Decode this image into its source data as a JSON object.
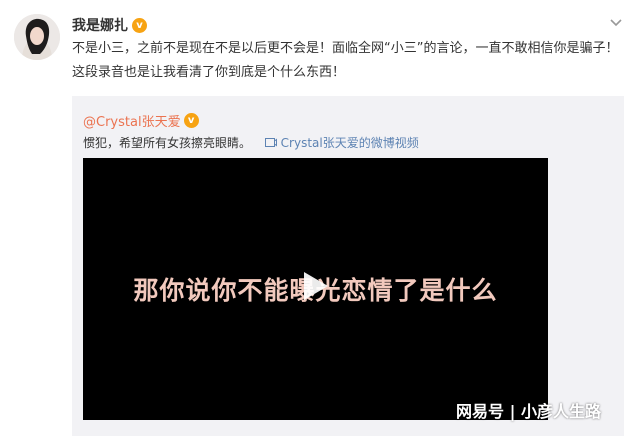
{
  "post": {
    "username": "我是娜扎",
    "verified_badge": "v",
    "text": "不是小三，之前不是现在不是以后更不会是！面临全网“小三”的言论，一直不敢相信你是骗子！这段录音也是让我看清了你到底是个什么东西！"
  },
  "repost": {
    "username": "@Crystal张天爱",
    "verified_badge": "v",
    "text": "惯犯，希望所有女孩擦亮眼睛。",
    "video_link": "Crystal张天爱的微博视频"
  },
  "video": {
    "subtitle": "那你说你不能曝光恋情了是什么"
  },
  "watermark": "网易号 | 小彦人生路",
  "icons": {
    "more": "chevron-down-icon",
    "play": "play-icon",
    "video_link": "video-link-icon"
  },
  "colors": {
    "username": "#333333",
    "repost_username": "#eb7350",
    "link": "#5d83b3",
    "badge": "#f7a313",
    "repost_bg": "#f2f2f5"
  }
}
